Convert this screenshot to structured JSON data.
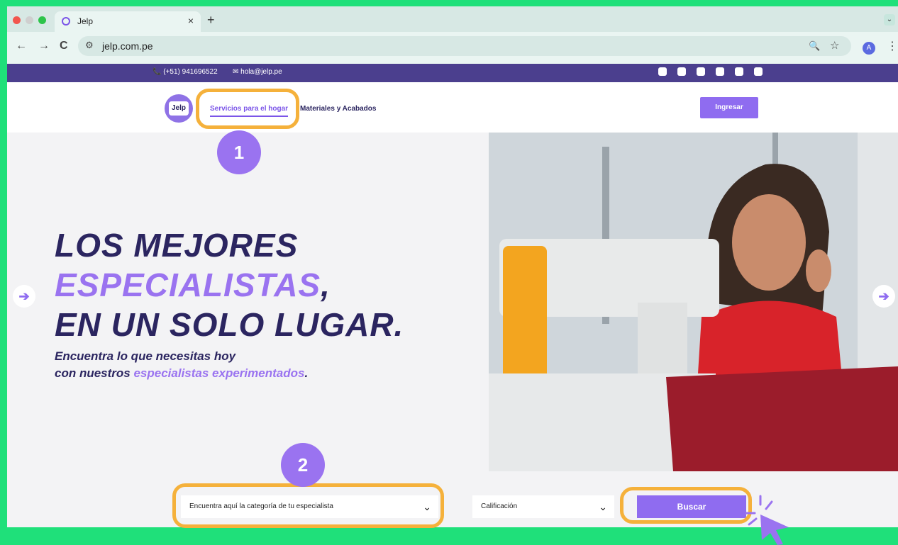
{
  "browser": {
    "tab_title": "Jelp",
    "tab_close": "×",
    "new_tab": "+",
    "url": "jelp.com.pe",
    "avatar_letter": "A",
    "back": "←",
    "forward": "→",
    "reload": "C",
    "site_info": "⚙",
    "zoom": "🔍",
    "bookmark": "☆",
    "menu": "⋮",
    "expand": "⌄"
  },
  "site": {
    "phone": "📞 (+51) 941696522",
    "email": "✉ hola@jelp.pe",
    "socials": [
      "whatsapp-icon",
      "facebook-icon",
      "linkedin-icon",
      "x-icon",
      "instagram-icon",
      "tiktok-icon"
    ],
    "logo_text": "Jelp",
    "nav": {
      "services": "Servicios para el hogar",
      "materials": "Materiales y Acabados",
      "login": "Ingresar"
    },
    "hero": {
      "line1": "LOS MEJORES",
      "line2": "ESPECIALISTAS",
      "line2_comma": ",",
      "line3": "EN UN SOLO LUGAR.",
      "sub1": "Encuentra lo que necesitas hoy",
      "sub2_prefix": "con nuestros ",
      "sub2_highlight": "especialistas experimentados",
      "sub2_suffix": "."
    },
    "search": {
      "category_placeholder": "Encuentra aquí la categoría de tu especialista",
      "rating_placeholder": "Calificación",
      "button": "Buscar"
    }
  },
  "annotations": {
    "step1": "1",
    "step2": "2",
    "highlight_color": "#f5b13b",
    "badge_color": "#9a73f0"
  },
  "colors": {
    "accent": "#8f6cf0",
    "dark_purple": "#2b2560",
    "topbar": "#4b3f8e",
    "background_frame": "#1fe07a"
  }
}
